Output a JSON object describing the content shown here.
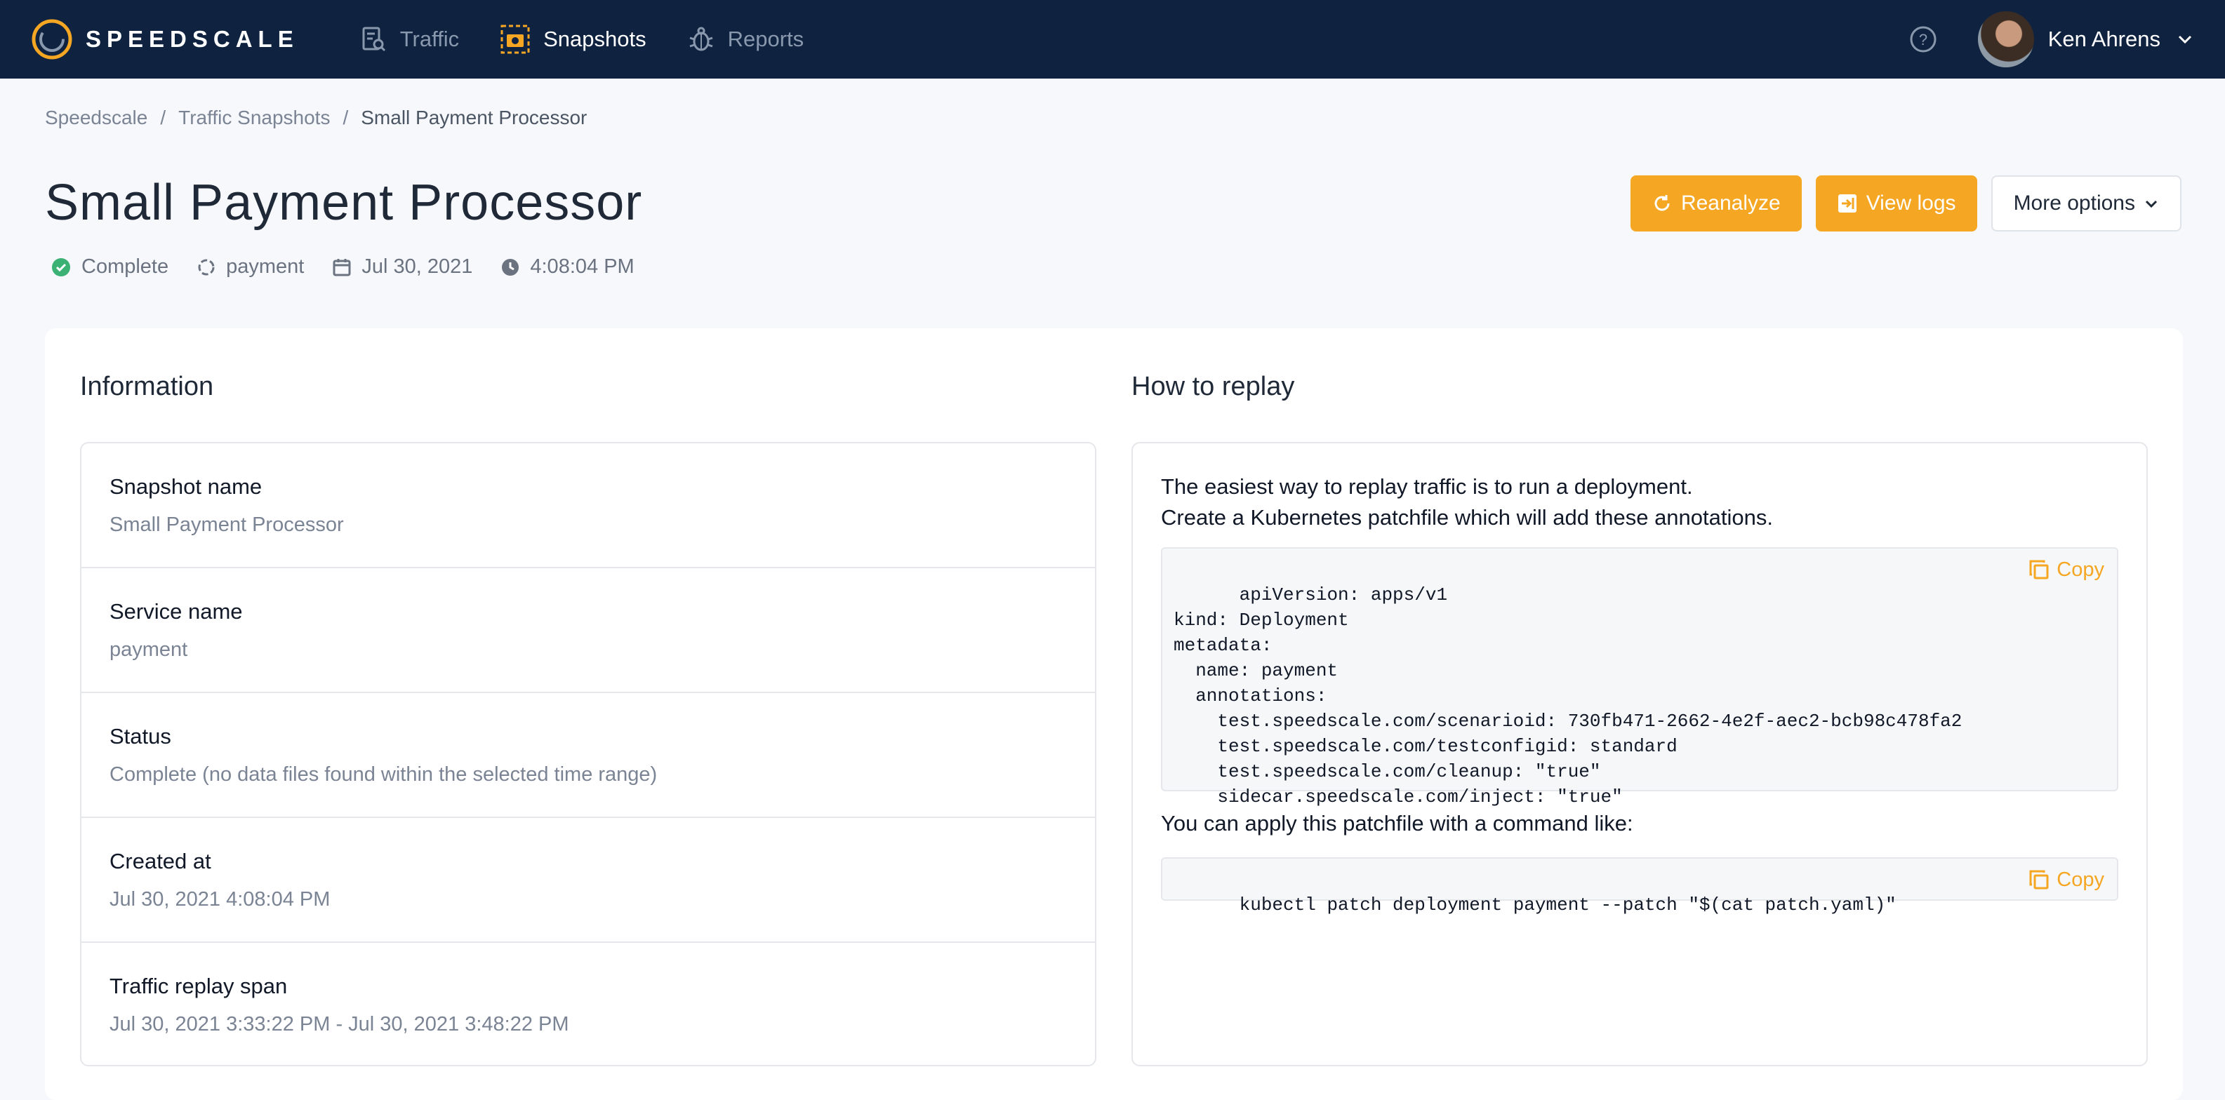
{
  "brand": {
    "name": "SPEEDSCALE",
    "accent": "#f5a623",
    "nav_bg": "#0f2340"
  },
  "nav": {
    "items": [
      {
        "label": "Traffic",
        "icon": "traffic-search-icon",
        "active": false
      },
      {
        "label": "Snapshots",
        "icon": "snapshot-camera-icon",
        "active": true
      },
      {
        "label": "Reports",
        "icon": "bug-icon",
        "active": false
      }
    ],
    "user_name": "Ken Ahrens"
  },
  "breadcrumb": [
    "Speedscale",
    "Traffic Snapshots",
    "Small Payment Processor"
  ],
  "page": {
    "title": "Small Payment Processor",
    "meta": {
      "status": "Complete",
      "service": "payment",
      "date": "Jul 30, 2021",
      "time": "4:08:04 PM"
    },
    "actions": {
      "reanalyze": "Reanalyze",
      "view_logs": "View logs",
      "more_options": "More options"
    }
  },
  "information": {
    "title": "Information",
    "rows": [
      {
        "label": "Snapshot name",
        "value": "Small Payment Processor"
      },
      {
        "label": "Service name",
        "value": "payment"
      },
      {
        "label": "Status",
        "value": "Complete (no data files found within the selected time range)"
      },
      {
        "label": "Created at",
        "value": "Jul 30, 2021 4:08:04 PM"
      },
      {
        "label": "Traffic replay span",
        "value": "Jul 30, 2021 3:33:22 PM - Jul 30, 2021 3:48:22 PM"
      }
    ]
  },
  "replay": {
    "title": "How to replay",
    "intro_line1": "The easiest way to replay traffic is to run a deployment.",
    "intro_line2": "Create a Kubernetes patchfile which will add these annotations.",
    "patchfile": "apiVersion: apps/v1\nkind: Deployment\nmetadata:\n  name: payment\n  annotations:\n    test.speedscale.com/scenarioid: 730fb471-2662-4e2f-aec2-bcb98c478fa2\n    test.speedscale.com/testconfigid: standard\n    test.speedscale.com/cleanup: \"true\"\n    sidecar.speedscale.com/inject: \"true\"",
    "apply_text": "You can apply this patchfile with a command like:",
    "command": "kubectl patch deployment payment --patch \"$(cat patch.yaml)\"",
    "copy_label": "Copy"
  }
}
